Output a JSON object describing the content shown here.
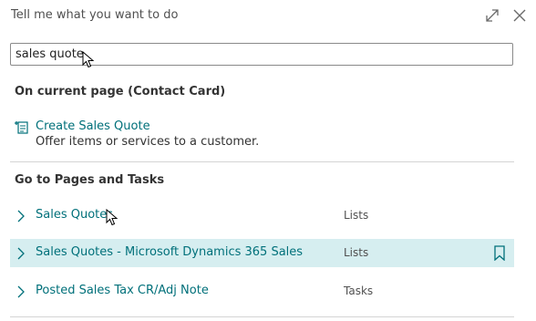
{
  "dialog": {
    "title": "Tell me what you want to do"
  },
  "search": {
    "value": "sales quote"
  },
  "current_page": {
    "heading": "On current page (Contact Card)",
    "action": {
      "icon": "create-document-icon",
      "title": "Create Sales Quote",
      "description": "Offer items or services to a customer."
    }
  },
  "pages_tasks": {
    "heading": "Go to Pages and Tasks",
    "results": [
      {
        "name": "Sales Quotes",
        "category": "Lists",
        "selected": false
      },
      {
        "name": "Sales Quotes - Microsoft Dynamics 365 Sales",
        "category": "Lists",
        "selected": true,
        "bookmark_icon": "bookmark-icon"
      },
      {
        "name": "Posted Sales Tax CR/Adj Note",
        "category": "Tasks",
        "selected": false
      }
    ]
  },
  "colors": {
    "accent": "#00707a",
    "selected_row": "#d6eef0"
  }
}
